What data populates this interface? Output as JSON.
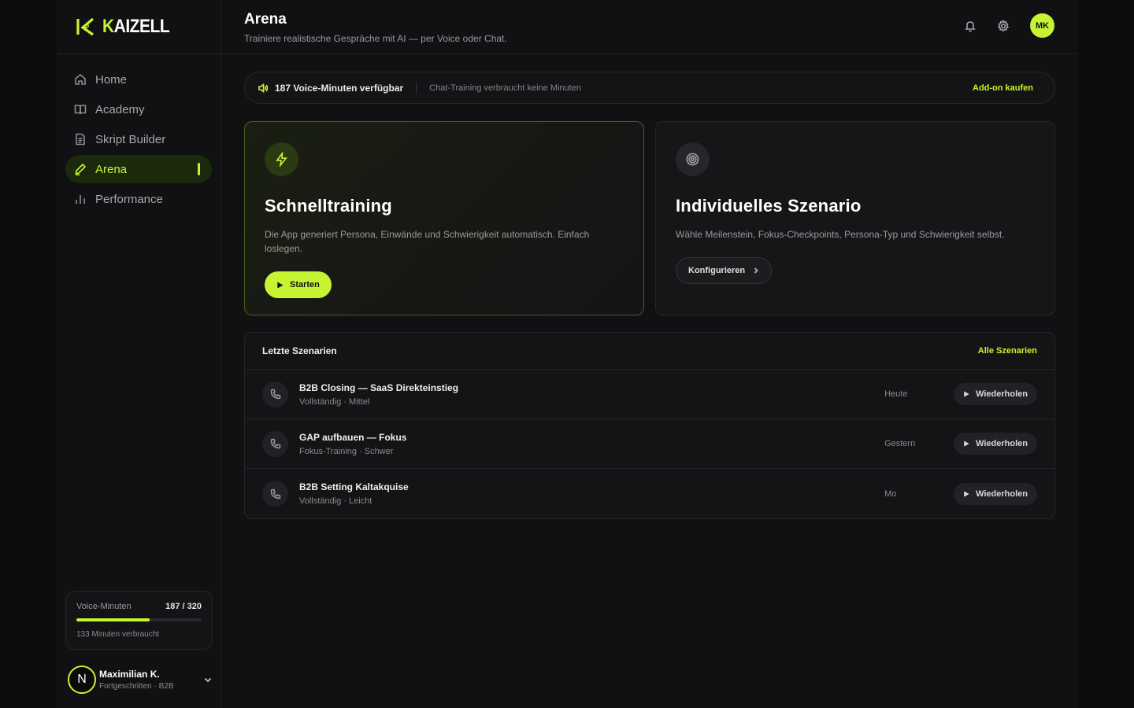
{
  "brand": {
    "name": "KAIZELL",
    "accent": "#c6f432"
  },
  "sidebar": {
    "items": [
      {
        "label": "Home",
        "icon": "home-icon",
        "active": false
      },
      {
        "label": "Academy",
        "icon": "book-icon",
        "active": false
      },
      {
        "label": "Skript Builder",
        "icon": "document-icon",
        "active": false
      },
      {
        "label": "Arena",
        "icon": "pen-icon",
        "active": true
      },
      {
        "label": "Performance",
        "icon": "bar-chart-icon",
        "active": false
      }
    ],
    "minutes": {
      "label": "Voice-Minuten",
      "value": "187 / 320",
      "progress_percent": 58.4,
      "used": "133 Minuten verbraucht"
    },
    "user": {
      "initial": "N",
      "name": "Maximilian K.",
      "subtitle": "Fortgeschritten · B2B"
    }
  },
  "header": {
    "title": "Arena",
    "subtitle": "Trainiere realistische Gespräche mit AI — per Voice oder Chat.",
    "avatar_initials": "MK"
  },
  "infobar": {
    "main": "187 Voice-Minuten verfügbar",
    "sub": "Chat-Training verbraucht keine Minuten",
    "link": "Add-on kaufen"
  },
  "cards": {
    "quick": {
      "title": "Schnelltraining",
      "description": "Die App generiert Persona, Einwände und Schwierigkeit automatisch. Einfach loslegen.",
      "button": "Starten"
    },
    "individual": {
      "title": "Individuelles Szenario",
      "description": "Wähle Meilenstein, Fokus-Checkpoints, Persona-Typ und Schwierigkeit selbst.",
      "button": "Konfigurieren"
    }
  },
  "recent": {
    "title": "Letzte Szenarien",
    "link": "Alle Szenarien",
    "rows": [
      {
        "name": "B2B Closing — SaaS Direkteinstieg",
        "meta": "Vollständig · Mittel",
        "date": "Heute",
        "action": "Wiederholen"
      },
      {
        "name": "GAP aufbauen — Fokus",
        "meta": "Fokus-Training · Schwer",
        "date": "Gestern",
        "action": "Wiederholen"
      },
      {
        "name": "B2B Setting Kaltakquise",
        "meta": "Vollständig · Leicht",
        "date": "Mo",
        "action": "Wiederholen"
      }
    ]
  }
}
